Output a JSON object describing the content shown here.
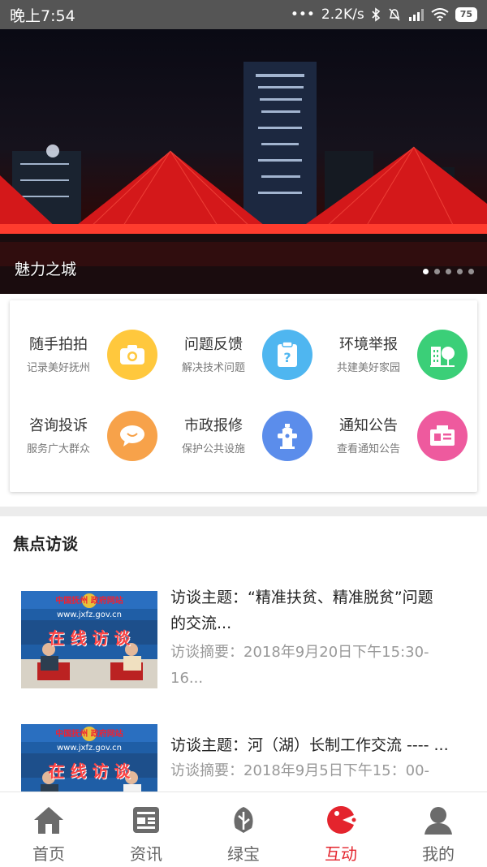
{
  "status_bar": {
    "time": "晚上7:54",
    "dots": "•••",
    "speed": "2.2K/s",
    "battery": "75"
  },
  "banner": {
    "caption": "魅力之城",
    "page_count": 5,
    "active_page": 1
  },
  "services": [
    {
      "title": "随手拍拍",
      "subtitle": "记录美好抚州",
      "icon": "camera-icon",
      "color": "#FFC83D"
    },
    {
      "title": "问题反馈",
      "subtitle": "解决技术问题",
      "icon": "question-clipboard-icon",
      "color": "#4FB6F0"
    },
    {
      "title": "环境举报",
      "subtitle": "共建美好家园",
      "icon": "building-tree-icon",
      "color": "#3BCF78"
    },
    {
      "title": "咨询投诉",
      "subtitle": "服务广大群众",
      "icon": "chat-bubble-icon",
      "color": "#F7A24A"
    },
    {
      "title": "市政报修",
      "subtitle": "保护公共设施",
      "icon": "fire-hydrant-icon",
      "color": "#5B8DEB"
    },
    {
      "title": "通知公告",
      "subtitle": "查看通知公告",
      "icon": "notice-board-icon",
      "color": "#EE5A9E"
    }
  ],
  "focus": {
    "section_title": "焦点访谈",
    "articles": [
      {
        "title_line1": "访谈主题：“精准扶贫、精准脱贫”问题",
        "title_line2": "的交流...",
        "summary_line1": "访谈摘要：2018年9月20日下午15:30-",
        "summary_line2": "16...",
        "thumb_header": "中国抚州  政府网站",
        "thumb_url": "www.jxfz.gov.cn",
        "thumb_banner": "在 线 访 谈"
      },
      {
        "title_line1": "访谈主题：河（湖）长制工作交流 ---- ...",
        "summary_line1": "访谈摘要：2018年9月5日下午15：00-",
        "thumb_header": "中国抚州  政府网站",
        "thumb_url": "www.jxfz.gov.cn",
        "thumb_banner": "在 线 访 谈"
      }
    ]
  },
  "tabs": [
    {
      "label": "首页",
      "icon": "home-icon"
    },
    {
      "label": "资讯",
      "icon": "news-icon"
    },
    {
      "label": "绿宝",
      "icon": "leaf-icon"
    },
    {
      "label": "互动",
      "icon": "interaction-icon",
      "active": true
    },
    {
      "label": "我的",
      "icon": "user-icon"
    }
  ],
  "colors": {
    "accent": "#e4242d",
    "tab_inactive": "#666666"
  }
}
